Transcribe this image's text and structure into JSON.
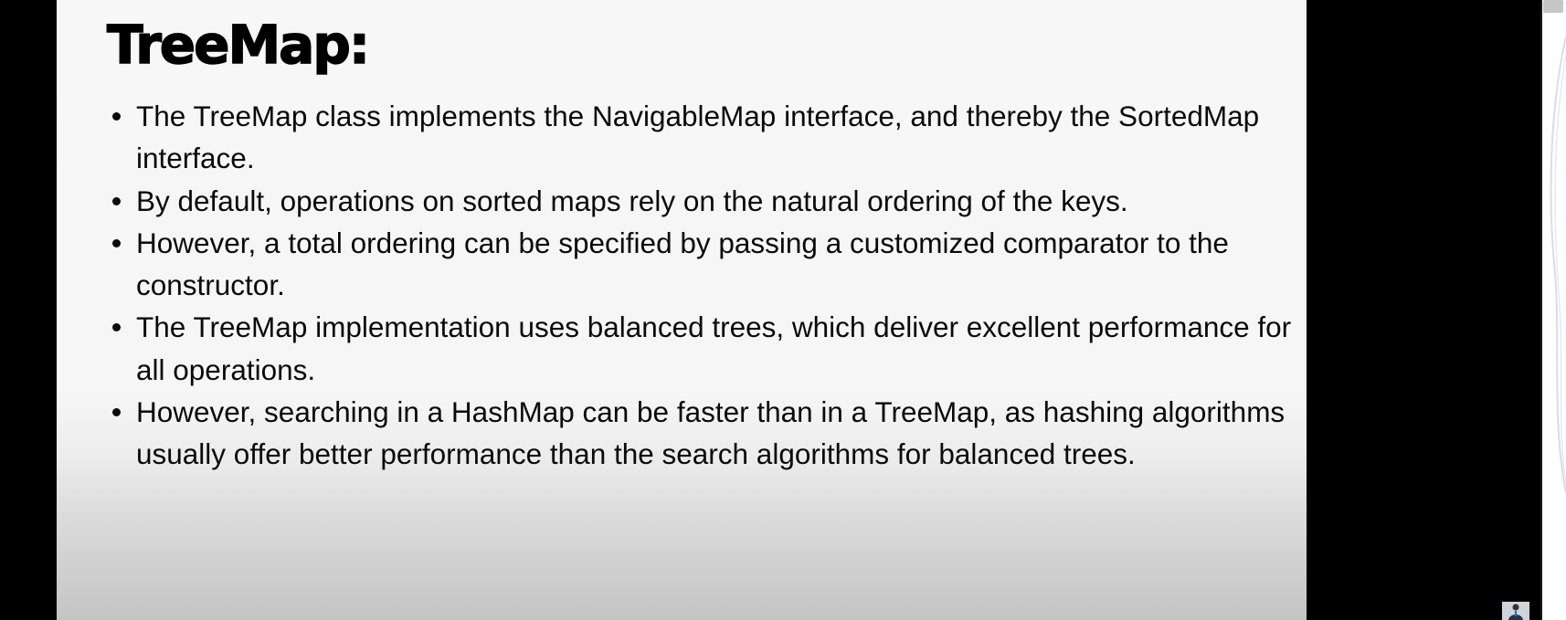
{
  "slide": {
    "title": "TreeMap:",
    "bullets": [
      "The TreeMap class implements the NavigableMap interface, and thereby the SortedMap interface.",
      "By default, operations on sorted maps rely on the natural ordering of the keys.",
      "However, a total ordering can be specified by passing a customized comparator to the constructor.",
      "The TreeMap implementation uses balanced trees, which deliver excellent performance for all operations.",
      "However, searching in a HashMap can be faster than in a TreeMap, as hashing algorithms usually offer better performance than the search algorithms for balanced trees."
    ]
  },
  "colors": {
    "background": "#000000",
    "slide_background": "#f6f6f6",
    "text": "#0a0a0a",
    "scrollbar": "#ffffff"
  },
  "icons": {
    "bullet": "bullet-dot-icon",
    "presenter": "presenter-avatar-icon"
  }
}
